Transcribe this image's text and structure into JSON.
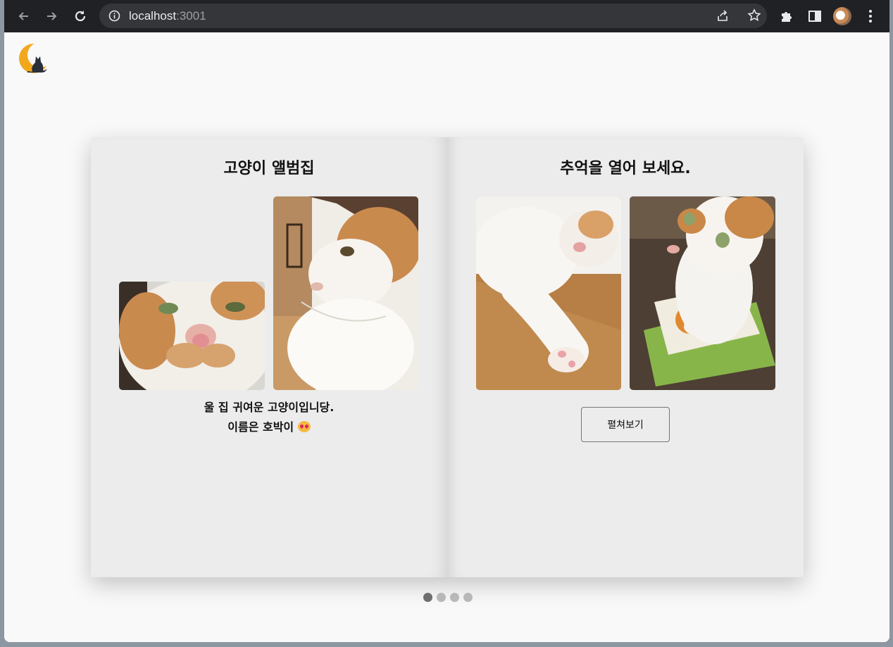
{
  "browser": {
    "url_host": "localhost",
    "url_port": ":3001"
  },
  "book": {
    "left_page": {
      "title": "고양이 앨범집",
      "caption_line1": "울 집 귀여운 고양이입니당.",
      "caption_line2": "이름은 호박이"
    },
    "right_page": {
      "title": "추억을 열어 보세요.",
      "open_button_label": "펼쳐보기"
    }
  },
  "pagination": {
    "total": 4,
    "active_index": 0
  },
  "colors": {
    "page_bg": "#f9f9f9",
    "book_page_bg": "#ebeceb",
    "chrome_bg": "#202124",
    "dot_active": "#6e6e6e",
    "dot_inactive": "#b8b8b8"
  }
}
